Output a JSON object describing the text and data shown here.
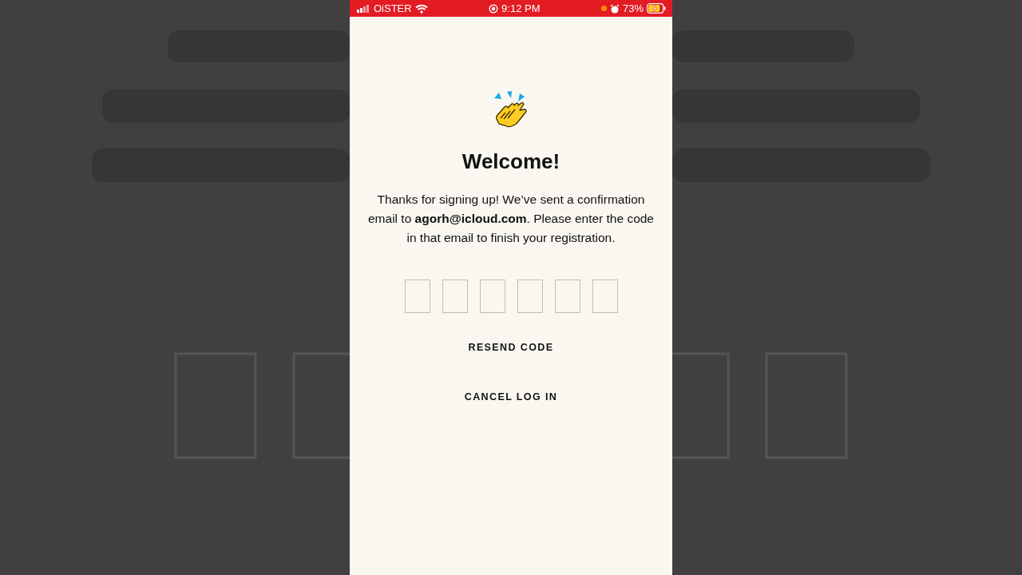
{
  "status_bar": {
    "carrier": "OiSTER",
    "time": "9:12 PM",
    "battery": "73%",
    "charging": true,
    "recording": true
  },
  "title": "Welcome!",
  "message": "Thanks for signing up! We’ve sent a confirmation email to **agorh@icloud.com**. Please enter the code in that email to finish your registration.",
  "code_fields": [
    {
      "kind": "empty"
    },
    {
      "kind": "empty"
    },
    {
      "kind": "empty"
    },
    {
      "kind": "empty"
    },
    {
      "kind": "empty"
    },
    {
      "kind": "empty"
    }
  ],
  "actions": [
    "RESEND CODE",
    "CANCEL LOG IN"
  ]
}
